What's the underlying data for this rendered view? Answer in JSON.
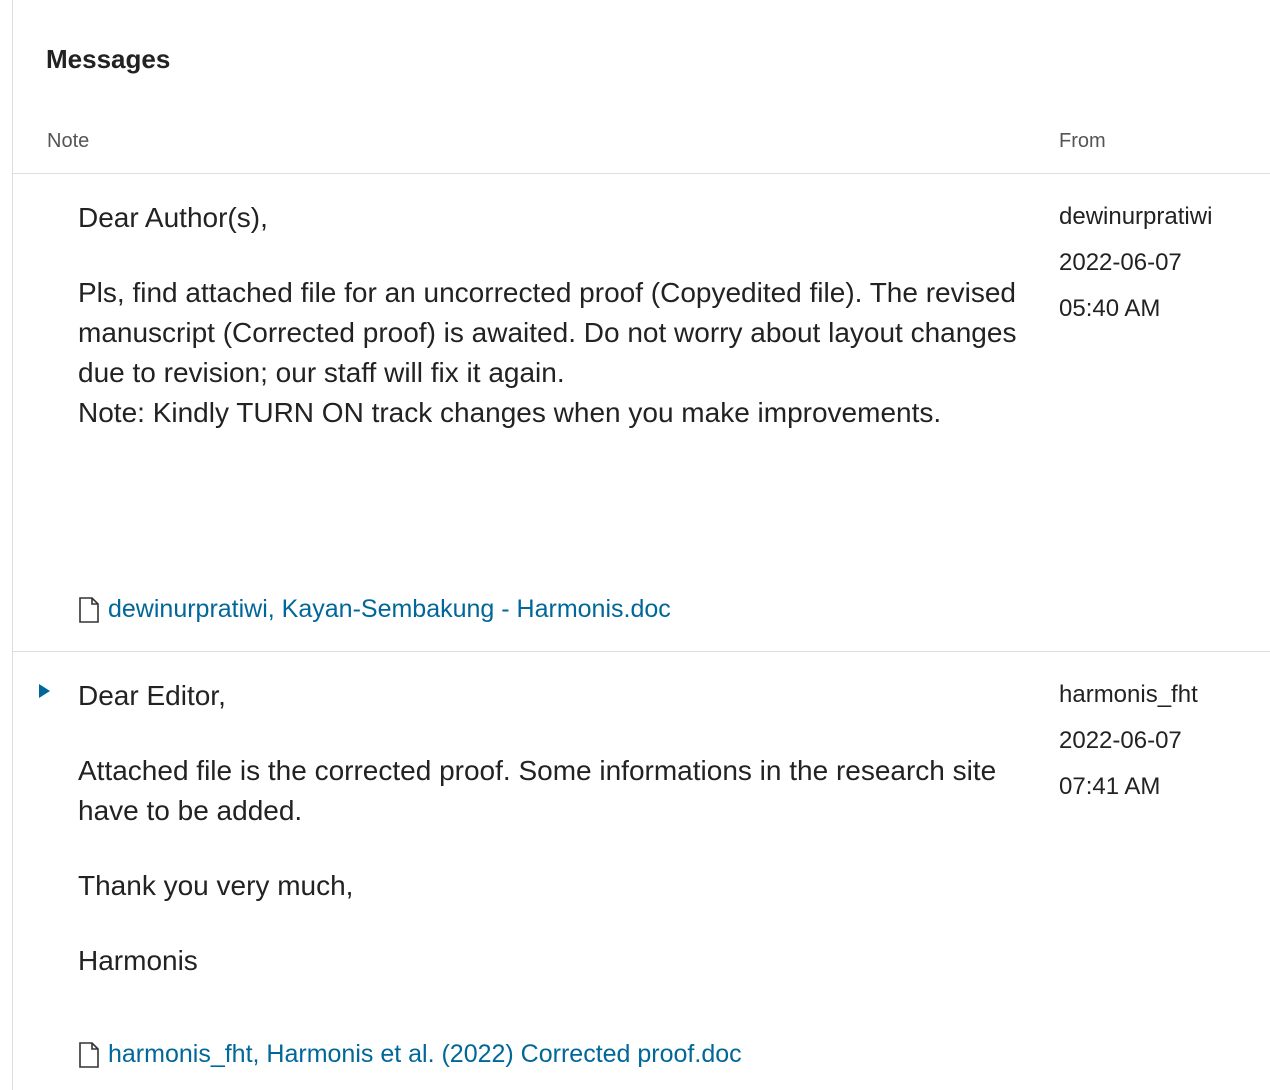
{
  "panel": {
    "title": "Messages",
    "columns": {
      "note": "Note",
      "from": "From"
    }
  },
  "messages": [
    {
      "paragraphs": [
        "Dear Author(s),",
        "Pls, find attached file for an uncorrected proof (Copyedited file). The revised manuscript (Corrected proof) is awaited. Do not worry about layout changes due to revision; our staff will fix it again.\nNote: Kindly TURN ON track changes when you make improvements."
      ],
      "attachment": "dewinurpratiwi, Kayan-Sembakung - Harmonis.doc",
      "from_user": "dewinurpratiwi",
      "date": "2022-06-07",
      "time": "05:40 AM"
    },
    {
      "paragraphs": [
        "Dear Editor,",
        "Attached file is the corrected proof. Some informations in the research site have to be added.",
        "Thank you very much,",
        "Harmonis"
      ],
      "attachment": "harmonis_fht, Harmonis et al. (2022) Corrected proof.doc",
      "from_user": "harmonis_fht",
      "date": "2022-06-07",
      "time": "07:41 AM"
    }
  ],
  "icons": {
    "attachment": "file-icon",
    "expand": "triangle-right-icon"
  },
  "colors": {
    "link": "#006798",
    "border": "#dddddd",
    "text": "#222222"
  }
}
